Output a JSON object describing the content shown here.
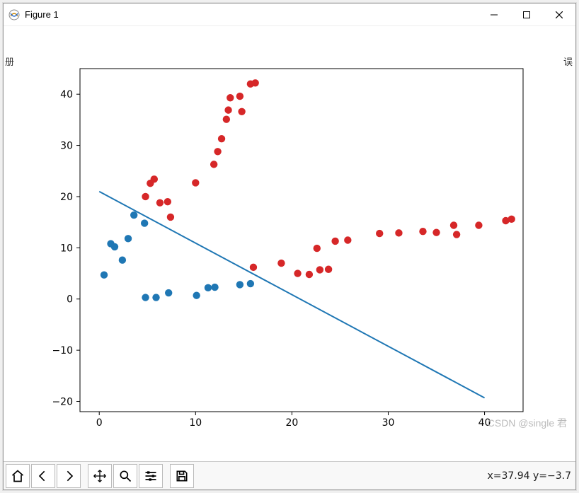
{
  "window": {
    "title": "Figure 1"
  },
  "side_text": {
    "left": "册",
    "right": "误"
  },
  "watermark": "CSDN @single 君",
  "status": {
    "text": "x=37.94  y=−3.7"
  },
  "toolbar": {
    "home": "home-icon",
    "back": "back-icon",
    "forward": "forward-icon",
    "pan": "pan-icon",
    "zoom": "zoom-icon",
    "configure": "configure-icon",
    "save": "save-icon"
  },
  "colors": {
    "series_blue": "#1f77b4",
    "series_red": "#d62728",
    "line": "#1f77b4",
    "axis": "#000000"
  },
  "chart_data": {
    "type": "scatter",
    "xlabel": "",
    "ylabel": "",
    "title": "",
    "xlim": [
      -2,
      44
    ],
    "ylim": [
      -22,
      45
    ],
    "xticks": [
      0,
      10,
      20,
      30,
      40
    ],
    "yticks": [
      -20,
      -10,
      0,
      10,
      20,
      30,
      40
    ],
    "series": [
      {
        "name": "blue",
        "color": "#1f77b4",
        "points": [
          {
            "x": 0.5,
            "y": 4.7
          },
          {
            "x": 1.2,
            "y": 10.8
          },
          {
            "x": 1.6,
            "y": 10.2
          },
          {
            "x": 2.4,
            "y": 7.6
          },
          {
            "x": 3.0,
            "y": 11.8
          },
          {
            "x": 3.6,
            "y": 16.4
          },
          {
            "x": 4.7,
            "y": 14.8
          },
          {
            "x": 4.8,
            "y": 0.3
          },
          {
            "x": 5.9,
            "y": 0.3
          },
          {
            "x": 7.2,
            "y": 1.2
          },
          {
            "x": 10.1,
            "y": 0.7
          },
          {
            "x": 11.3,
            "y": 2.2
          },
          {
            "x": 12.0,
            "y": 2.3
          },
          {
            "x": 14.6,
            "y": 2.8
          },
          {
            "x": 15.7,
            "y": 3.0
          }
        ]
      },
      {
        "name": "red",
        "color": "#d62728",
        "points": [
          {
            "x": 4.8,
            "y": 20.0
          },
          {
            "x": 5.3,
            "y": 22.6
          },
          {
            "x": 5.7,
            "y": 23.4
          },
          {
            "x": 6.3,
            "y": 18.8
          },
          {
            "x": 7.1,
            "y": 19.0
          },
          {
            "x": 7.4,
            "y": 16.0
          },
          {
            "x": 10.0,
            "y": 22.7
          },
          {
            "x": 11.9,
            "y": 26.3
          },
          {
            "x": 12.3,
            "y": 28.8
          },
          {
            "x": 12.7,
            "y": 31.3
          },
          {
            "x": 13.2,
            "y": 35.1
          },
          {
            "x": 13.4,
            "y": 36.9
          },
          {
            "x": 13.6,
            "y": 39.3
          },
          {
            "x": 14.6,
            "y": 39.6
          },
          {
            "x": 14.8,
            "y": 36.6
          },
          {
            "x": 15.7,
            "y": 42.0
          },
          {
            "x": 16.2,
            "y": 42.2
          },
          {
            "x": 16.0,
            "y": 6.2
          },
          {
            "x": 18.9,
            "y": 7.0
          },
          {
            "x": 20.6,
            "y": 5.0
          },
          {
            "x": 21.8,
            "y": 4.8
          },
          {
            "x": 22.9,
            "y": 5.7
          },
          {
            "x": 22.6,
            "y": 9.9
          },
          {
            "x": 23.8,
            "y": 5.8
          },
          {
            "x": 24.5,
            "y": 11.3
          },
          {
            "x": 25.8,
            "y": 11.5
          },
          {
            "x": 29.1,
            "y": 12.8
          },
          {
            "x": 31.1,
            "y": 12.9
          },
          {
            "x": 33.6,
            "y": 13.2
          },
          {
            "x": 35.0,
            "y": 13.0
          },
          {
            "x": 36.8,
            "y": 14.4
          },
          {
            "x": 37.1,
            "y": 12.6
          },
          {
            "x": 39.4,
            "y": 14.4
          },
          {
            "x": 42.2,
            "y": 15.3
          },
          {
            "x": 42.8,
            "y": 15.6
          }
        ]
      }
    ],
    "line": {
      "x0": 0,
      "y0": 21,
      "x1": 40,
      "y1": -19.3
    }
  }
}
